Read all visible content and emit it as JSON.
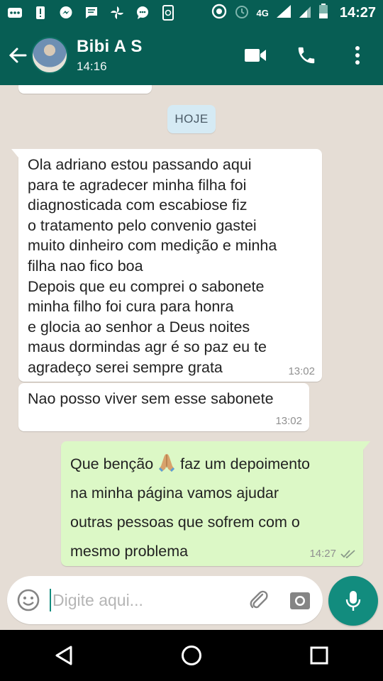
{
  "status_bar": {
    "time": "14:27",
    "network": "4G",
    "icons": [
      "messenger-dots-icon",
      "alert-icon",
      "messenger-icon",
      "message-icon",
      "pinwheel-icon",
      "chat-bubble-icon",
      "phone-sync-icon",
      "data-saver-icon",
      "alarm-icon",
      "signal-icon",
      "battery-icon"
    ]
  },
  "header": {
    "contact_name": "Bibi A S",
    "last_seen": "14:16",
    "colors": {
      "primary": "#075e54",
      "accent": "#128c7e"
    }
  },
  "chat": {
    "date_chip": "HOJE",
    "messages": [
      {
        "direction": "incoming",
        "text": "Ola adriano estou passando  aqui\npara te agradecer minha filha foi\ndiagnosticada com escabiose fiz\no tratamento pelo convenio gastei\nmuito dinheiro com medição e minha\nfilha nao fico boa\nDepois que eu comprei o  sabonete\nminha filho foi cura para  honra\ne glocia ao senhor a Deus noites\nmaus dormindas agr é so paz  eu te\nagradeço serei sempre grata",
        "time": "13:02"
      },
      {
        "direction": "incoming",
        "text": "Nao posso viver sem esse sabonete",
        "time": "13:02"
      },
      {
        "direction": "outgoing",
        "text_before": "Que benção",
        "text_after": "faz um depoimento\nna minha página vamos ajudar\noutras pessoas que sofrem com o\nmesmo problema",
        "emoji": "folded-hands-icon",
        "time": "14:27",
        "status": "read-ticks-icon"
      }
    ]
  },
  "composer": {
    "placeholder": "Digite aqui..."
  }
}
